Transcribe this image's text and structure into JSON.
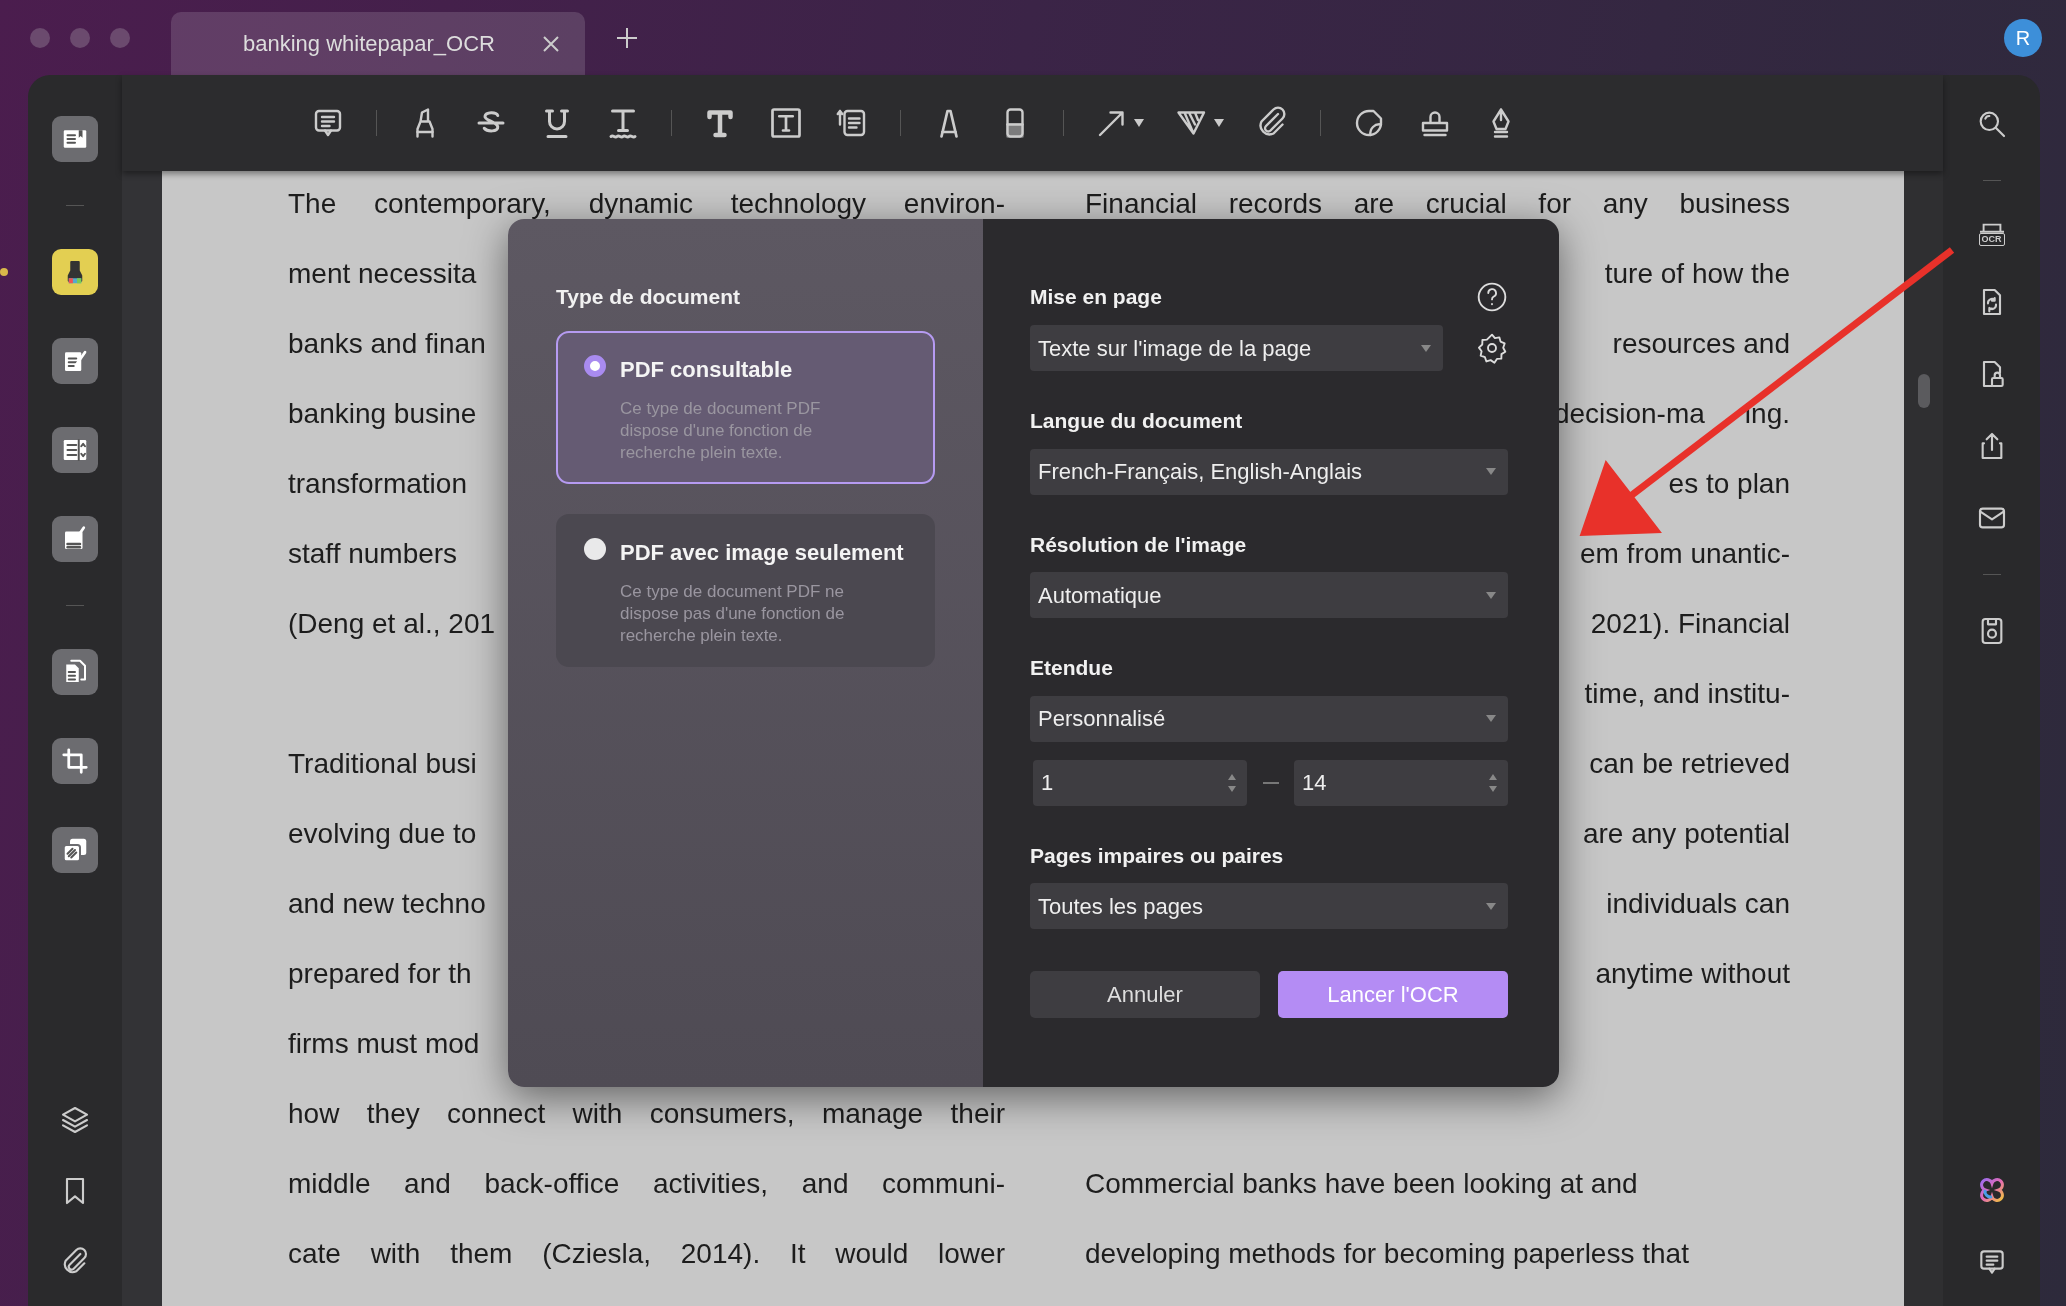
{
  "tab": {
    "title": "banking whitepapar_OCR"
  },
  "avatar": "R",
  "left_sidebar": {
    "tools": [
      {
        "selected": false
      },
      {
        "selected": true
      },
      {
        "selected": false
      },
      {
        "selected": false
      },
      {
        "selected": false
      },
      {
        "selected": false
      },
      {
        "selected": false
      },
      {
        "selected": false
      }
    ]
  },
  "right_toolbar": {
    "ocr_label": "OCR"
  },
  "document": {
    "rows": [
      {
        "left": {
          "text": "The contemporary, dynamic technology environ-",
          "kind": "full"
        },
        "right": {
          "text": "Financial records are crucial for any business",
          "kind": "full"
        }
      },
      {
        "left": {
          "text": "ment necessita",
          "kind": "cut"
        },
        "right": {
          "text": "ture of how the",
          "kind": "cut"
        }
      },
      {
        "left": {
          "text": "banks and finan",
          "kind": "cut"
        },
        "right": {
          "text": "resources and",
          "kind": "cut"
        }
      },
      {
        "left": {
          "text": "banking busine",
          "kind": "cut"
        },
        "right": {
          "text": "decision-ma",
          "kind": "cut",
          "trailing": "ing."
        }
      },
      {
        "left": {
          "text": "transformation",
          "kind": "cut"
        },
        "right": {
          "text": "es to plan",
          "kind": "cut"
        }
      },
      {
        "left": {
          "text": "staff numbers",
          "kind": "cut"
        },
        "right": {
          "text": "em from unantic-",
          "kind": "cut"
        }
      },
      {
        "left": {
          "text": "(Deng et al., 201",
          "kind": "cut"
        },
        "right": {
          "text": "2021). Financial",
          "kind": "cut"
        }
      },
      {
        "right": {
          "text": "time, and institu-",
          "kind": "cut"
        }
      },
      {
        "left": {
          "text": "Traditional busi",
          "kind": "cut"
        },
        "right": {
          "text": "can be retrieved",
          "kind": "cut"
        }
      },
      {
        "left": {
          "text": "evolving due to",
          "kind": "cut"
        },
        "right": {
          "text": "are any potential",
          "kind": "cut"
        }
      },
      {
        "left": {
          "text": "and new techno",
          "kind": "cut"
        },
        "right": {
          "text": "individuals can",
          "kind": "cut"
        }
      },
      {
        "left": {
          "text": "prepared for th",
          "kind": "cut"
        },
        "right": {
          "text": "anytime without",
          "kind": "cut"
        }
      },
      {
        "left": {
          "text": "firms must mod",
          "kind": "cut"
        }
      },
      {
        "left": {
          "text": "how they connect with consumers, manage their",
          "kind": "full"
        }
      },
      {
        "left": {
          "text": "middle and back-office activities, and communi-",
          "kind": "full"
        },
        "right": {
          "text": "Commercial banks have been looking at and",
          "kind": "plain"
        }
      },
      {
        "left": {
          "text": "cate with them (Cziesla, 2014). It would lower",
          "kind": "full"
        },
        "right": {
          "text": "developing methods for becoming paperless that",
          "kind": "plain"
        }
      }
    ]
  },
  "ocr_dialog": {
    "document_type": {
      "heading": "Type de document",
      "options": [
        {
          "title": "PDF consultable",
          "description": "Ce type de document PDF dispose d'une fonction de recherche plein texte.",
          "selected": true
        },
        {
          "title": "PDF avec image seulement",
          "description": "Ce type de document PDF ne dispose pas d'une fonction de recherche plein texte.",
          "selected": false
        }
      ]
    },
    "layout": {
      "label": "Mise en page",
      "value": "Texte sur l'image de la page"
    },
    "language": {
      "label": "Langue du document",
      "value": "French-Français, English-Anglais"
    },
    "resolution": {
      "label": "Résolution de l'image",
      "value": "Automatique"
    },
    "range": {
      "label": "Etendue",
      "value": "Personnalisé",
      "from": "1",
      "to": "14"
    },
    "pages": {
      "label": "Pages impaires ou paires",
      "value": "Toutes les pages"
    },
    "buttons": [
      {
        "label": "Annuler",
        "kind": "secondary"
      },
      {
        "label": "Lancer l'OCR",
        "kind": "primary"
      }
    ]
  }
}
